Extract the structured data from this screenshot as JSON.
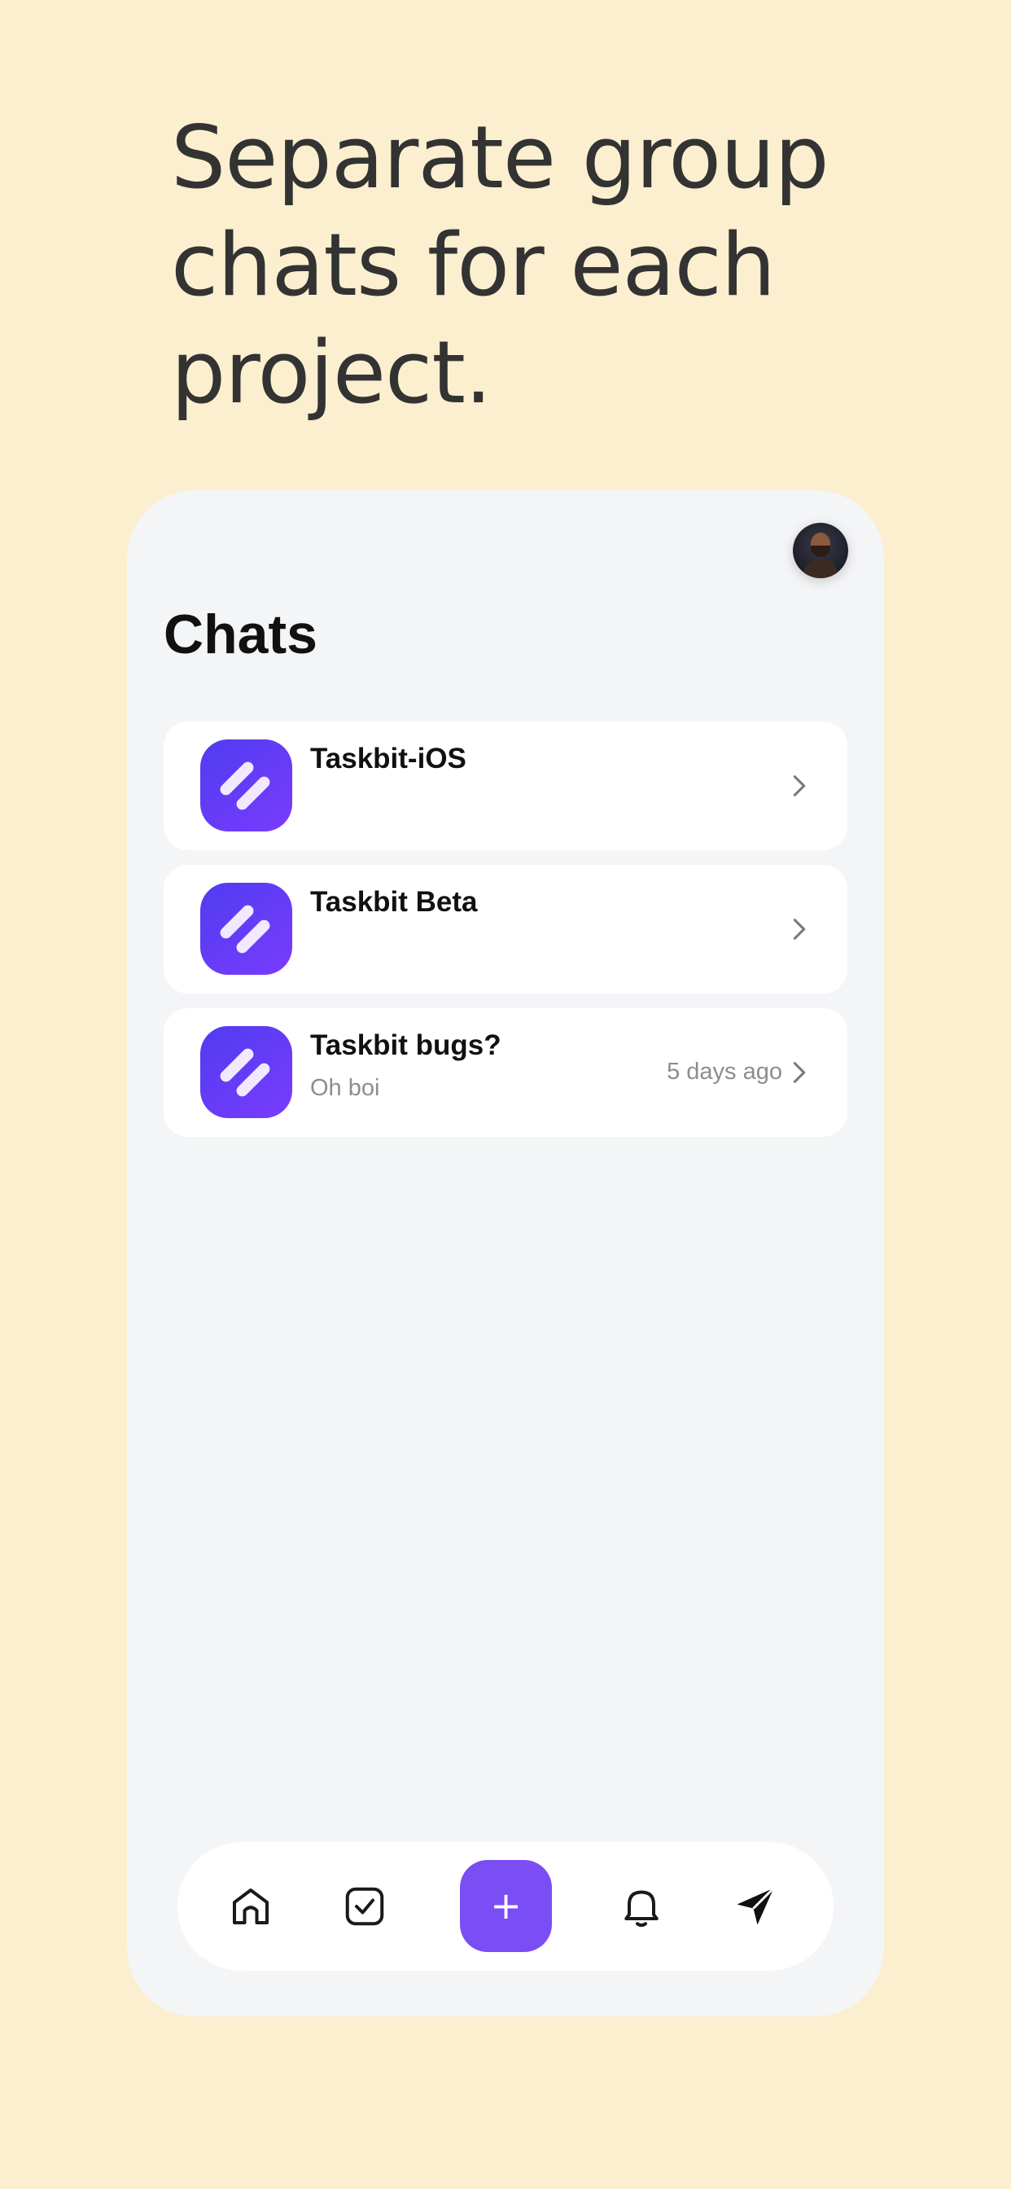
{
  "headline": "Separate group chats for each project.",
  "screen": {
    "title": "Chats",
    "avatar_icon": "user-avatar"
  },
  "chats": [
    {
      "name": "Taskbit-iOS",
      "preview": "",
      "time": "",
      "icon": "taskbit-logo-icon"
    },
    {
      "name": "Taskbit Beta",
      "preview": "",
      "time": "",
      "icon": "taskbit-logo-icon"
    },
    {
      "name": "Taskbit bugs?",
      "preview": "Oh boi",
      "time": "5 days ago",
      "icon": "taskbit-logo-icon"
    }
  ],
  "tabbar": {
    "items": [
      "home-icon",
      "tasks-checkbox-icon",
      "add-icon",
      "bell-icon",
      "send-icon"
    ],
    "add_label": "+"
  },
  "colors": {
    "background": "#fbefcf",
    "screen": "#f4f5f7",
    "accent": "#7a4df5",
    "text": "#333333"
  }
}
